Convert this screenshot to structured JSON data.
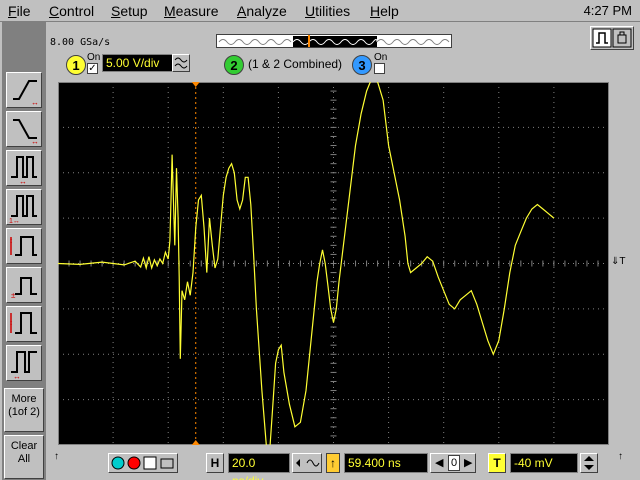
{
  "menu": {
    "items": [
      {
        "label": "File",
        "ul": "F",
        "rest": "ile"
      },
      {
        "label": "Control",
        "ul": "C",
        "rest": "ontrol"
      },
      {
        "label": "Setup",
        "ul": "S",
        "rest": "etup"
      },
      {
        "label": "Measure",
        "ul": "M",
        "rest": "easure"
      },
      {
        "label": "Analyze",
        "ul": "A",
        "rest": "nalyze"
      },
      {
        "label": "Utilities",
        "ul": "U",
        "rest": "tilities"
      },
      {
        "label": "Help",
        "ul": "H",
        "rest": "elp"
      }
    ],
    "clock": "4:27 PM"
  },
  "acquisition": {
    "sample_rate": "8.00 GSa/s"
  },
  "channels": {
    "ch1": {
      "number": "1",
      "on_label": "On",
      "on": true,
      "scale": "5.00 V/div",
      "color": "#ffff33"
    },
    "ch2": {
      "number": "2",
      "label": "(1 & 2 Combined)",
      "color": "#33cc33"
    },
    "ch3": {
      "number": "3",
      "on_label": "On",
      "on": false,
      "color": "#3399ff"
    }
  },
  "sidebar": {
    "more_label_1": "More",
    "more_label_2": "(1of 2)",
    "clear_label_1": "Clear",
    "clear_label_2": "All"
  },
  "horizontal": {
    "label": "H",
    "scale": "20.0 ns/div",
    "position": "59.400 ns",
    "ref_value": "0"
  },
  "trigger": {
    "label": "T",
    "level": "-40 mV",
    "marker": "T"
  },
  "colors": {
    "trace": "#ffff33",
    "grid": "#808080",
    "marker": "#ff8800"
  },
  "chart_data": {
    "type": "line",
    "series": [
      {
        "values_div": [
          [
            -5.0,
            0.0
          ],
          [
            -4.6,
            -0.02
          ],
          [
            -4.2,
            0.03
          ],
          [
            -3.8,
            -0.03
          ],
          [
            -3.6,
            0.05
          ],
          [
            -3.5,
            -0.08
          ],
          [
            -3.45,
            0.12
          ],
          [
            -3.4,
            -0.1
          ],
          [
            -3.35,
            0.15
          ],
          [
            -3.3,
            -0.1
          ],
          [
            -3.25,
            0.08
          ],
          [
            -3.2,
            -0.05
          ],
          [
            -3.15,
            0.1
          ],
          [
            -3.1,
            0.0
          ],
          [
            -3.05,
            0.25
          ],
          [
            -3.0,
            0.1
          ],
          [
            -2.97,
            0.5
          ],
          [
            -2.95,
            1.4
          ],
          [
            -2.93,
            2.4
          ],
          [
            -2.9,
            1.2
          ],
          [
            -2.88,
            0.4
          ],
          [
            -2.85,
            2.1
          ],
          [
            -2.82,
            1.0
          ],
          [
            -2.8,
            -0.3
          ],
          [
            -2.78,
            -2.1
          ],
          [
            -2.75,
            -0.6
          ],
          [
            -2.7,
            -0.8
          ],
          [
            -2.65,
            -0.4
          ],
          [
            -2.6,
            -0.7
          ],
          [
            -2.55,
            -0.2
          ],
          [
            -2.5,
            0.8
          ],
          [
            -2.45,
            1.4
          ],
          [
            -2.4,
            1.5
          ],
          [
            -2.35,
            0.8
          ],
          [
            -2.3,
            -0.2
          ],
          [
            -2.25,
            1.0
          ],
          [
            -2.2,
            0.4
          ],
          [
            -2.15,
            -0.1
          ],
          [
            -2.1,
            0.1
          ],
          [
            -2.05,
            0.8
          ],
          [
            -2.0,
            1.5
          ],
          [
            -1.95,
            1.9
          ],
          [
            -1.9,
            2.1
          ],
          [
            -1.85,
            2.2
          ],
          [
            -1.8,
            2.0
          ],
          [
            -1.75,
            1.4
          ],
          [
            -1.7,
            1.2
          ],
          [
            -1.65,
            1.4
          ],
          [
            -1.6,
            1.9
          ],
          [
            -1.55,
            1.9
          ],
          [
            -1.5,
            1.3
          ],
          [
            -1.45,
            0.2
          ],
          [
            -1.4,
            -1.0
          ],
          [
            -1.3,
            -2.8
          ],
          [
            -1.2,
            -4.3
          ],
          [
            -1.15,
            -4.0
          ],
          [
            -1.1,
            -3.1
          ],
          [
            -1.05,
            -2.2
          ],
          [
            -1.0,
            -1.9
          ],
          [
            -0.95,
            -1.8
          ],
          [
            -0.9,
            -2.4
          ],
          [
            -0.8,
            -3.1
          ],
          [
            -0.7,
            -3.6
          ],
          [
            -0.6,
            -3.5
          ],
          [
            -0.5,
            -2.8
          ],
          [
            -0.4,
            -1.6
          ],
          [
            -0.3,
            -0.4
          ],
          [
            -0.25,
            0.0
          ],
          [
            -0.2,
            0.3
          ],
          [
            -0.15,
            0.0
          ],
          [
            -0.1,
            -0.5
          ],
          [
            -0.05,
            -1.0
          ],
          [
            0.0,
            -1.3
          ],
          [
            0.05,
            -1.0
          ],
          [
            0.1,
            -0.4
          ],
          [
            0.2,
            0.6
          ],
          [
            0.3,
            1.6
          ],
          [
            0.4,
            2.6
          ],
          [
            0.5,
            3.3
          ],
          [
            0.6,
            3.8
          ],
          [
            0.7,
            4.1
          ],
          [
            0.8,
            4.0
          ],
          [
            0.9,
            3.6
          ],
          [
            1.0,
            2.6
          ],
          [
            1.1,
            2.0
          ],
          [
            1.2,
            1.4
          ],
          [
            1.3,
            0.6
          ],
          [
            1.35,
            0.0
          ],
          [
            1.4,
            -0.2
          ],
          [
            1.5,
            -0.1
          ],
          [
            1.6,
            0.0
          ],
          [
            1.7,
            0.15
          ],
          [
            1.8,
            0.05
          ],
          [
            1.9,
            -0.3
          ],
          [
            2.0,
            -0.6
          ],
          [
            2.1,
            -0.9
          ],
          [
            2.2,
            -1.0
          ],
          [
            2.3,
            -0.8
          ],
          [
            2.4,
            -0.7
          ],
          [
            2.5,
            -0.6
          ],
          [
            2.6,
            -0.9
          ],
          [
            2.7,
            -1.3
          ],
          [
            2.8,
            -1.7
          ],
          [
            2.9,
            -2.0
          ],
          [
            3.0,
            -1.7
          ],
          [
            3.1,
            -1.0
          ],
          [
            3.2,
            -0.2
          ],
          [
            3.3,
            0.4
          ],
          [
            3.4,
            0.7
          ],
          [
            3.5,
            1.0
          ],
          [
            3.6,
            1.2
          ],
          [
            3.7,
            1.3
          ],
          [
            3.8,
            1.2
          ],
          [
            3.9,
            1.1
          ],
          [
            4.0,
            1.0
          ]
        ]
      }
    ],
    "xlim": [
      -5,
      5
    ],
    "ylim": [
      -4,
      4
    ],
    "grid": true
  }
}
